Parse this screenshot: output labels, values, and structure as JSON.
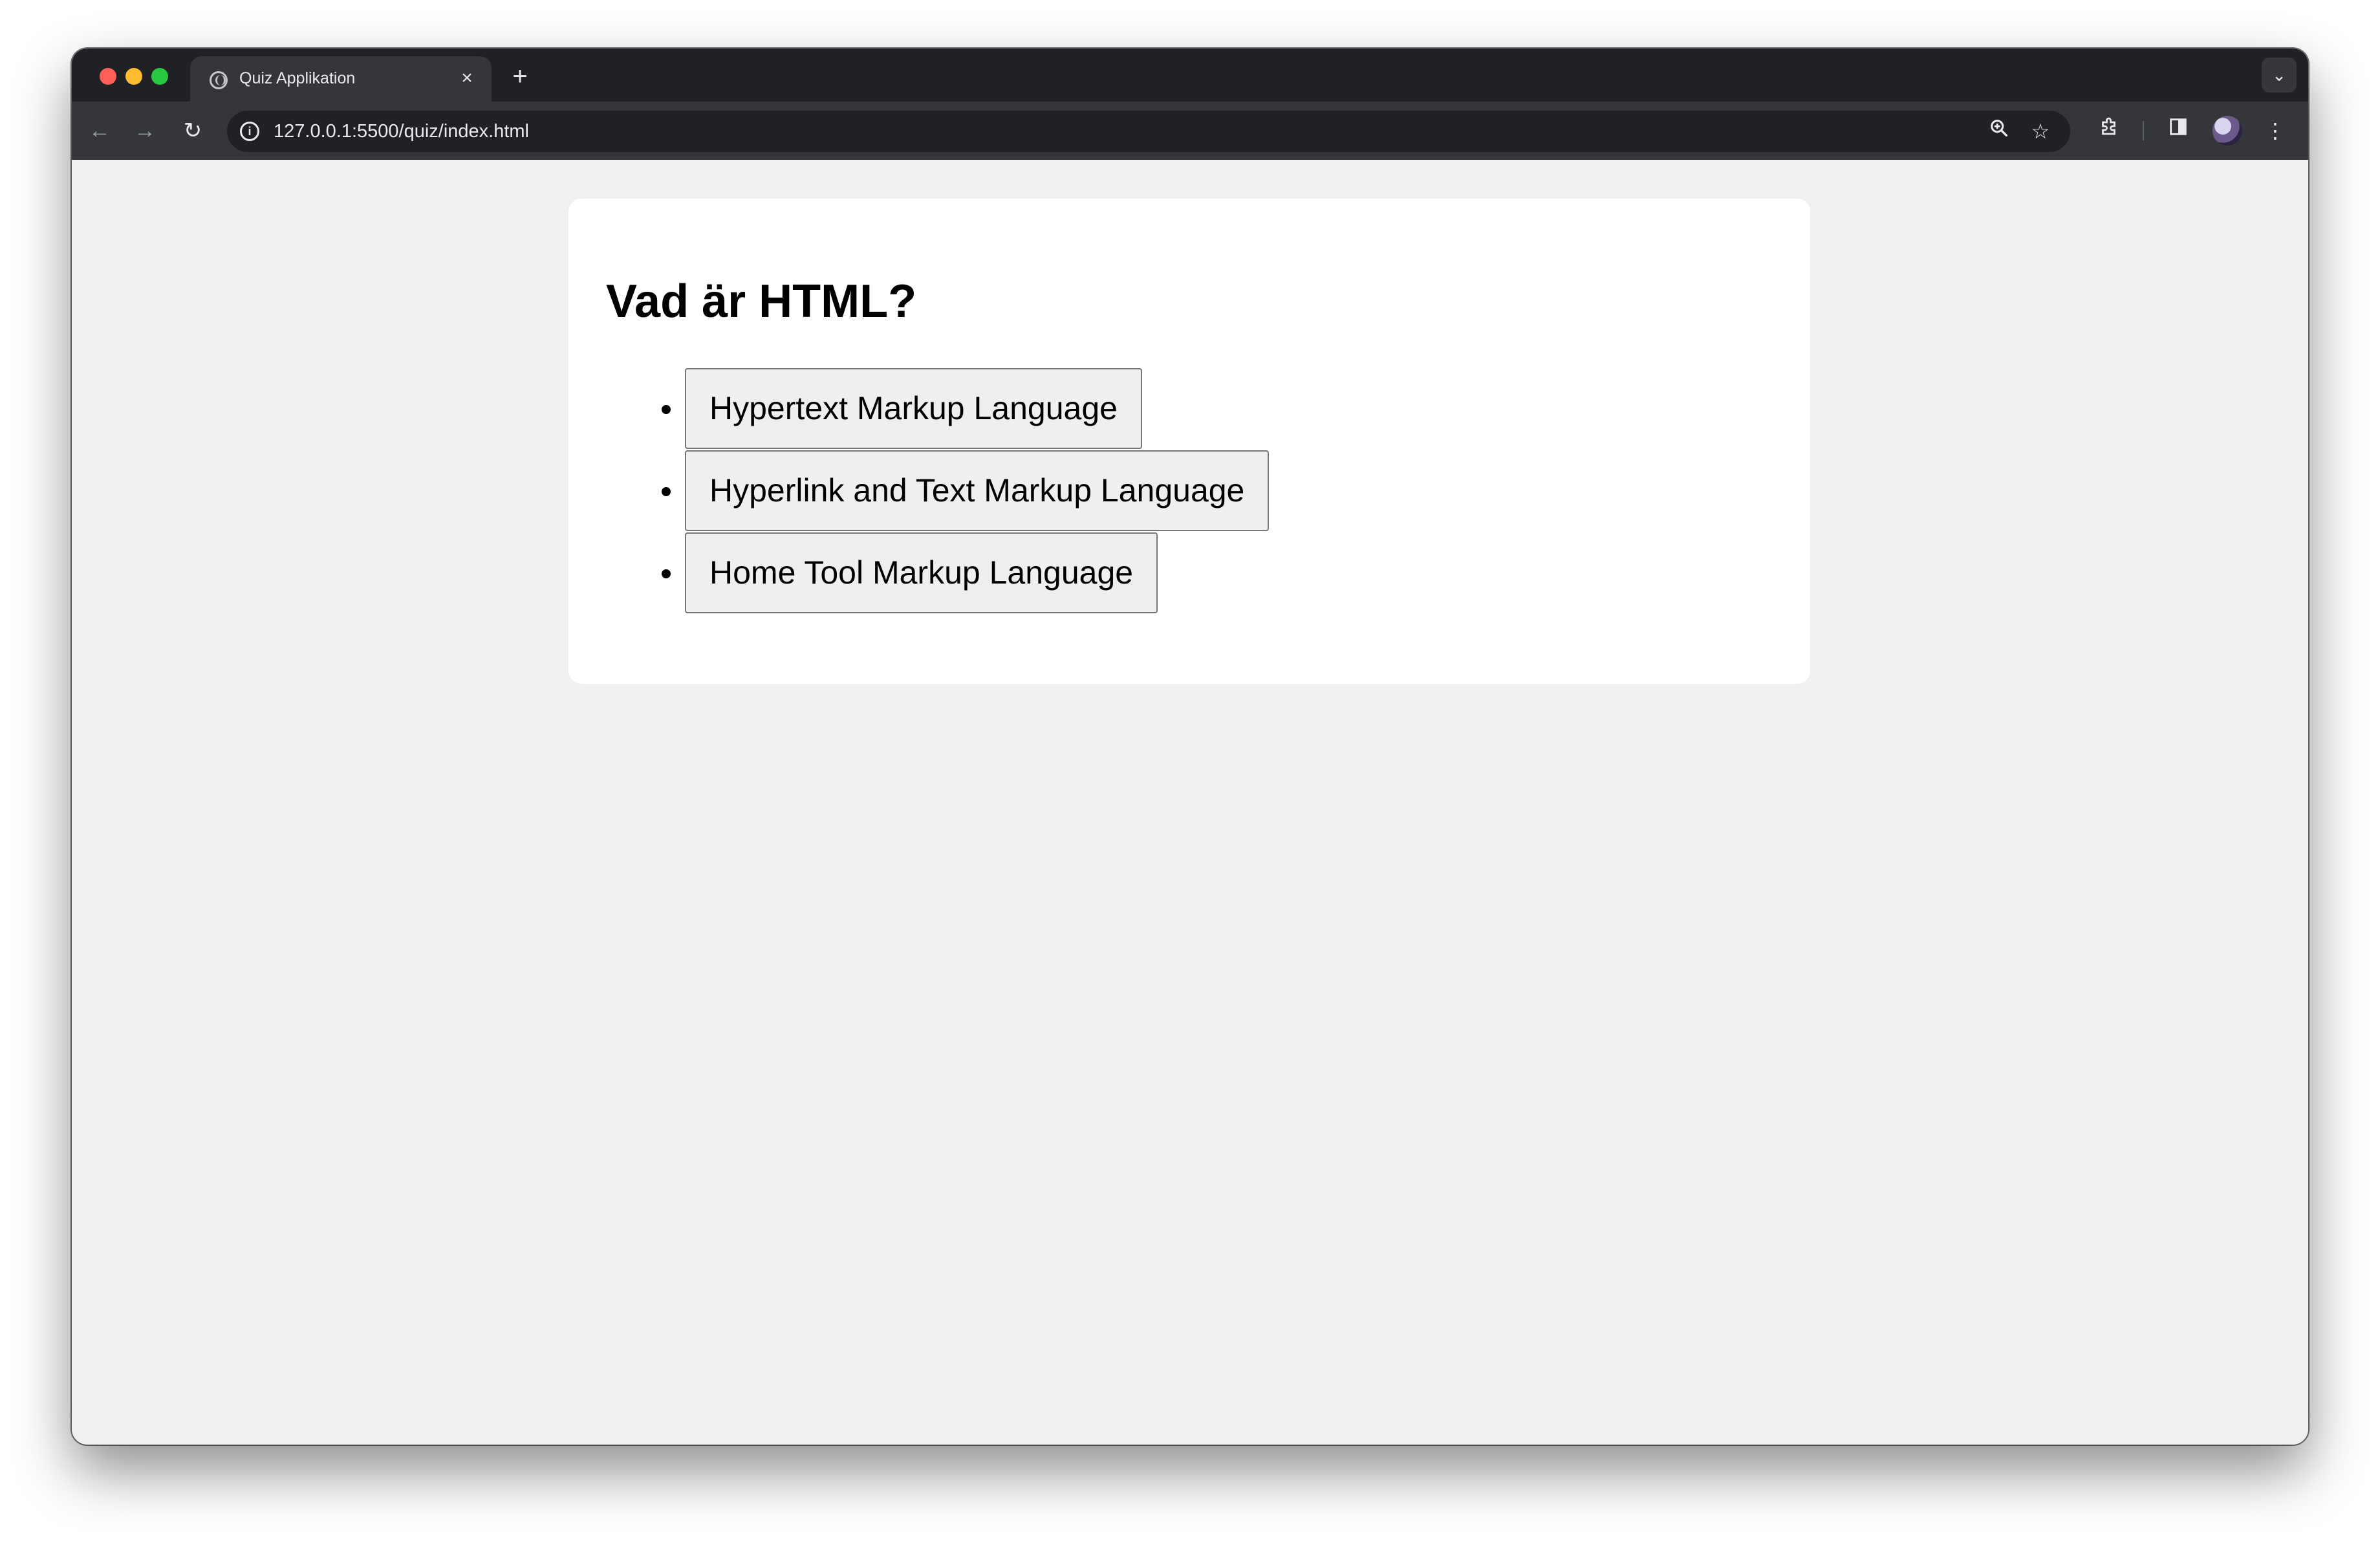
{
  "browser": {
    "tab_title": "Quiz Applikation",
    "tab_close": "×",
    "new_tab": "+",
    "tab_menu": "⌄",
    "url": "127.0.0.1:5500/quiz/index.html",
    "icons": {
      "back": "back-arrow-icon",
      "forward": "forward-arrow-icon",
      "reload": "reload-icon",
      "site_info": "info-icon",
      "zoom": "zoom-icon",
      "bookmark": "star-icon",
      "extensions": "puzzle-icon",
      "side_panel": "side-panel-icon",
      "profile": "avatar",
      "menu": "kebab-menu-icon"
    }
  },
  "quiz": {
    "question": "Vad är HTML?",
    "answers": [
      {
        "label": "Hypertext Markup Language"
      },
      {
        "label": "Hyperlink and Text Markup Language"
      },
      {
        "label": "Home Tool Markup Language"
      }
    ]
  },
  "colors": {
    "page_background": "#f0f0f0",
    "card_background": "#ffffff",
    "button_background": "#efefef",
    "button_border": "#767676",
    "chrome_dark": "#202124",
    "chrome_toolbar": "#35363a"
  }
}
